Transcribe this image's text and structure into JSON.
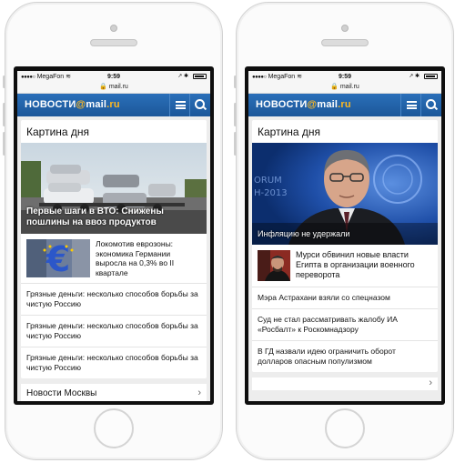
{
  "left": {
    "status": {
      "carrier": "MegaFon",
      "time": "9:59",
      "icons": "↗ ✱"
    },
    "url": "🔒 mail.ru",
    "logo": {
      "main": "НОВОСТИ",
      "at": "@",
      "brand": "mail",
      "tld": ".ru"
    },
    "card_title": "Картина дня",
    "hero_caption": "Первые шаги в ВТО: Снижены пошлины на ввоз продуктов",
    "news_row": {
      "text": "Локомотив еврозоны: экономика Германии выросла на 0,3% во II квартале"
    },
    "list": [
      "Грязные деньги: несколько способов борьбы за чистую Россию",
      "Грязные деньги: несколько способов борьбы за чистую Россию",
      "Грязные деньги: несколько способов борьбы за чистую Россию"
    ],
    "section_peek": "Новости Москвы"
  },
  "right": {
    "status": {
      "carrier": "MegaFon",
      "time": "9:59",
      "icons": "↗ ✱"
    },
    "url": "🔒 mail.ru",
    "logo": {
      "main": "НОВОСТИ",
      "at": "@",
      "brand": "mail",
      "tld": ".ru"
    },
    "card_title": "Картина дня",
    "hero_caption": "Инфляцию не удержали",
    "news_row": {
      "text": "Мурси обвинил новые власти Египта в организации военного переворота"
    },
    "list": [
      "Мэра Астрахани взяли со спецназом",
      "Суд не стал рассматривать жалобу ИА «Росбалт» к Роскомнадзору",
      "В ГД назвали идею ограничить оборот долларов опасным популизмом"
    ]
  },
  "colors": {
    "navbar": "#1f5fa6",
    "logo_accent": "#ffb820"
  }
}
